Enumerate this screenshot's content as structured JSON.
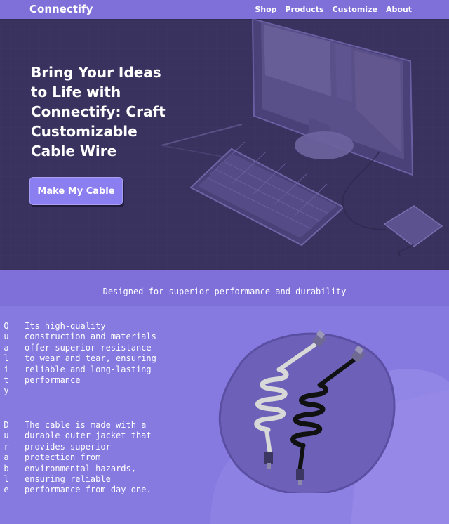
{
  "header": {
    "brand": "Connectify",
    "nav": [
      "Shop",
      "Products",
      "Customize",
      "About"
    ]
  },
  "hero": {
    "title": "Bring Your Ideas to Life with Connectify: Craft Customizable Cable Wire",
    "cta_label": "Make My Cable",
    "illustration": "computer-desk-illustration"
  },
  "features": {
    "tagline": "Designed for superior performance and durability",
    "items": [
      {
        "label": "Quality",
        "text": "Its high-quality construction and materials offer superior resistance to wear and tear, ensuring reliable and long-lasting performance"
      },
      {
        "label": "Durable",
        "text": "The cable is made with a durable outer jacket that provides superior protection from environmental hazards, ensuring reliable performance from day one."
      }
    ],
    "illustration": "coiled-cables-illustration"
  },
  "colors": {
    "header_bg": "#7f6fd8",
    "hero_bg": "#3a325e",
    "button_bg": "#8b7ef0",
    "section_bg": "#8679e0"
  }
}
